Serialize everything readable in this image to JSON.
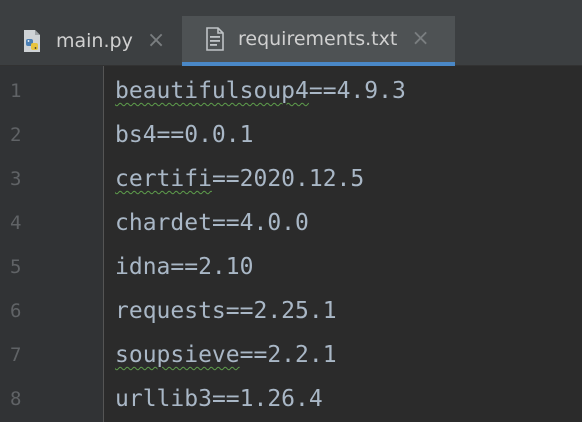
{
  "tabs": [
    {
      "label": "main.py",
      "icon": "python-file-icon",
      "active": false
    },
    {
      "label": "requirements.txt",
      "icon": "text-file-icon",
      "active": true
    }
  ],
  "close_symbol": "×",
  "editor": {
    "line_numbers": [
      "1",
      "2",
      "3",
      "4",
      "5",
      "6",
      "7",
      "8"
    ],
    "lines": [
      {
        "name": "beautifulsoup4",
        "rest": "==4.9.3",
        "spellcheck": true
      },
      {
        "name": "bs4",
        "rest": "==0.0.1",
        "spellcheck": false
      },
      {
        "name": "certifi",
        "rest": "==2020.12.5",
        "spellcheck": true
      },
      {
        "name": "chardet",
        "rest": "==4.0.0",
        "spellcheck": false
      },
      {
        "name": "idna",
        "rest": "==2.10",
        "spellcheck": false
      },
      {
        "name": "requests",
        "rest": "==2.25.1",
        "spellcheck": false
      },
      {
        "name": "soupsieve",
        "rest": "==2.2.1",
        "spellcheck": true
      },
      {
        "name": "urllib3",
        "rest": "==1.26.4",
        "spellcheck": false
      }
    ]
  },
  "colors": {
    "background": "#2b2b2b",
    "gutter": "#313335",
    "tab_active": "#4e5254",
    "tab_underline": "#4a88c7",
    "text": "#a9b7c6",
    "spellcheck": "#5e9e4c"
  }
}
